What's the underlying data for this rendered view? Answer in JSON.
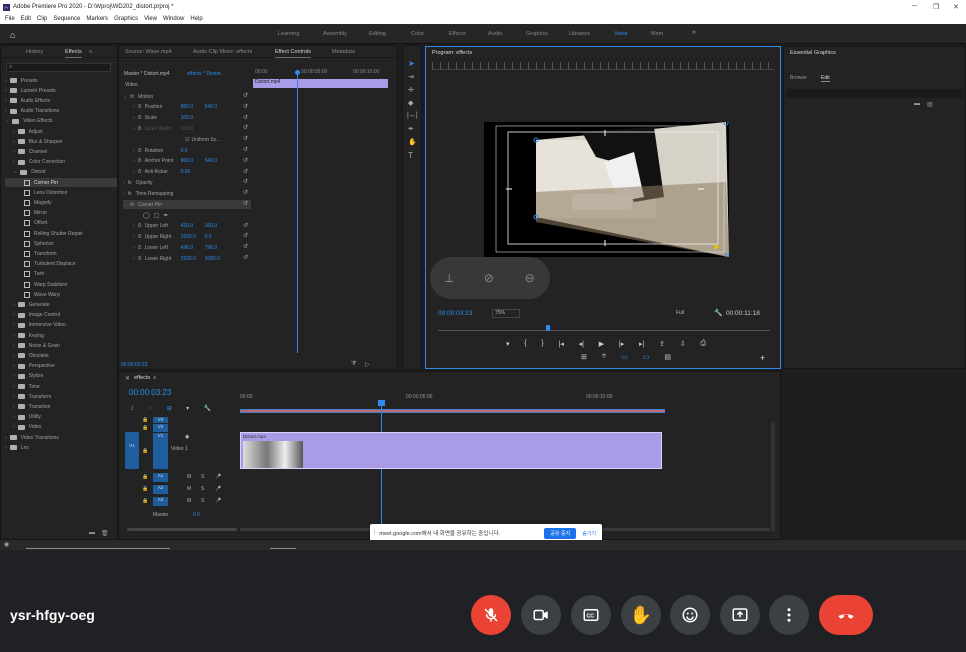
{
  "titlebar": {
    "app": "Adobe Premiere Pro 2020 - D:\\Wproj\\WD202_distort.prproj *",
    "icon": "Pr"
  },
  "menu": [
    "File",
    "Edit",
    "Clip",
    "Sequence",
    "Markers",
    "Graphics",
    "View",
    "Window",
    "Help"
  ],
  "workspaces": [
    "Learning",
    "Assembly",
    "Editing",
    "Color",
    "Effects",
    "Audio",
    "Graphics",
    "Libraries",
    "Vanie",
    "Mem"
  ],
  "workspace_active": "Vanie",
  "effects_panel": {
    "tabs": [
      "History",
      "Effects"
    ],
    "search_placeholder": "",
    "items": [
      {
        "label": "Presets",
        "level": 0
      },
      {
        "label": "Lumetri Presets",
        "level": 0
      },
      {
        "label": "Audio Effects",
        "level": 0
      },
      {
        "label": "Audio Transitions",
        "level": 0
      },
      {
        "label": "Video Effects",
        "level": 0,
        "open": true
      },
      {
        "label": "Adjust",
        "level": 1
      },
      {
        "label": "Blur & Sharpen",
        "level": 1
      },
      {
        "label": "Channel",
        "level": 1
      },
      {
        "label": "Color Correction",
        "level": 1
      },
      {
        "label": "Distort",
        "level": 1,
        "open": true
      },
      {
        "label": "Corner Pin",
        "level": 2,
        "selected": true
      },
      {
        "label": "Lens Distortion",
        "level": 2
      },
      {
        "label": "Magnify",
        "level": 2
      },
      {
        "label": "Mirror",
        "level": 2
      },
      {
        "label": "Offset",
        "level": 2
      },
      {
        "label": "Rolling Shutter Repair",
        "level": 2
      },
      {
        "label": "Spherize",
        "level": 2
      },
      {
        "label": "Transform",
        "level": 2
      },
      {
        "label": "Turbulent Displace",
        "level": 2
      },
      {
        "label": "Twirl",
        "level": 2
      },
      {
        "label": "Warp Stabilizer",
        "level": 2
      },
      {
        "label": "Wave Warp",
        "level": 2
      },
      {
        "label": "Generate",
        "level": 1
      },
      {
        "label": "Image Control",
        "level": 1
      },
      {
        "label": "Immersive Video",
        "level": 1
      },
      {
        "label": "Keying",
        "level": 1
      },
      {
        "label": "Noise & Grain",
        "level": 1
      },
      {
        "label": "Obsolete",
        "level": 1
      },
      {
        "label": "Perspective",
        "level": 1
      },
      {
        "label": "Stylize",
        "level": 1
      },
      {
        "label": "Time",
        "level": 1
      },
      {
        "label": "Transform",
        "level": 1
      },
      {
        "label": "Transition",
        "level": 1
      },
      {
        "label": "Utility",
        "level": 1
      },
      {
        "label": "Video",
        "level": 1
      },
      {
        "label": "Video Transitions",
        "level": 0
      },
      {
        "label": "Lns",
        "level": 0
      }
    ]
  },
  "effect_controls": {
    "tabs": [
      "Source: Wave.mp4",
      "Audio Clip Mixer: effects",
      "Effect Controls",
      "Metadata"
    ],
    "header": "Master * Distort.mp4",
    "seq": "effects * Distort...",
    "ruler": [
      "00:00",
      "00:00:05:00",
      "00:00:10:00"
    ],
    "clip": "Distort.mp4",
    "video_label": "Video",
    "timecode": "00:00:03:23",
    "rows": [
      {
        "label": "Motion",
        "type": "group"
      },
      {
        "label": "Position",
        "v1": "960.0",
        "v2": "540.0"
      },
      {
        "label": "Scale",
        "v1": "100.0"
      },
      {
        "label": "Scale Width",
        "v1": "100.0",
        "dim": true
      },
      {
        "label": "Uniform Sc...",
        "type": "check"
      },
      {
        "label": "Rotation",
        "v1": "0.0"
      },
      {
        "label": "Anchor Point",
        "v1": "960.0",
        "v2": "540.0"
      },
      {
        "label": "Anti-flicker",
        "v1": "0.00"
      },
      {
        "label": "Opacity",
        "type": "group"
      },
      {
        "label": "Time Remapping",
        "type": "group"
      },
      {
        "label": "Corner Pin",
        "type": "group"
      },
      {
        "label": "",
        "type": "shapes"
      },
      {
        "label": "Upper Left",
        "v1": "420.0",
        "v2": "160.0"
      },
      {
        "label": "Upper Right",
        "v1": "1920.0",
        "v2": "0.0"
      },
      {
        "label": "Lower Left",
        "v1": "436.0",
        "v2": "796.0"
      },
      {
        "label": "Lower Right",
        "v1": "1920.0",
        "v2": "1080.0"
      }
    ]
  },
  "program": {
    "title": "Program: effects",
    "timecode": "00:00:03:23",
    "zoom": "75%",
    "quality": "Full",
    "duration": "00:00:11:18"
  },
  "essential_graphics": {
    "title": "Essential Graphics",
    "tabs": [
      "Browse",
      "Edit"
    ],
    "active": "Edit"
  },
  "timeline": {
    "tab": "effects",
    "timecode": "00:00:03:23",
    "ruler": [
      "00:00",
      "00:00:05:00",
      "00:00:10:00"
    ],
    "video_tracks": [
      {
        "name": "V3"
      },
      {
        "name": "V2"
      },
      {
        "name": "V1",
        "label": "Video 1"
      }
    ],
    "audio_tracks": [
      {
        "name": "A1"
      },
      {
        "name": "A2"
      },
      {
        "name": "A3"
      }
    ],
    "master": "Master",
    "master_val": "0.0",
    "clip_name": "Distort.mp4"
  },
  "share_bar": {
    "text": "meet.google.com에서 내 화면을 공유하는 중입니다.",
    "stop": "공유 중지",
    "hide": "숨기기"
  },
  "meet": {
    "code": "ysr-hfgy-oeg",
    "colors": {
      "red": "#ea4335",
      "btn": "#3c4043",
      "bg": "#202124"
    },
    "buttons": [
      "mic-off-icon",
      "camera-icon",
      "captions-icon",
      "raise-hand-icon",
      "emoji-icon",
      "present-icon",
      "more-icon",
      "hangup-icon"
    ]
  }
}
